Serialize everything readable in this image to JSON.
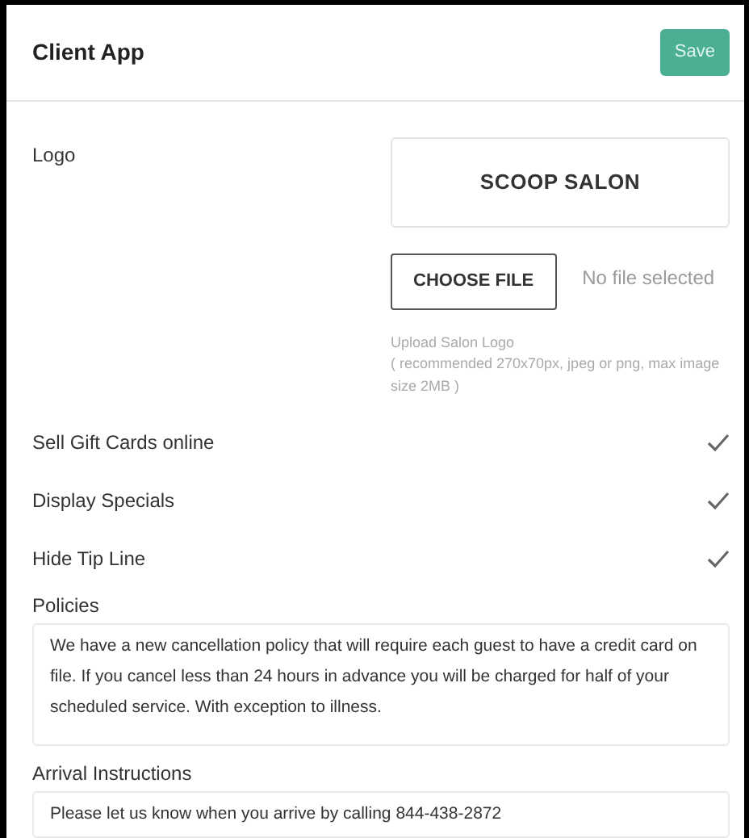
{
  "header": {
    "title": "Client App",
    "save_button": "Save"
  },
  "logo": {
    "label": "Logo",
    "image_text": "SCOOP SALON",
    "choose_button": "CHOOSE FILE",
    "file_status": "No file selected",
    "help_title": "Upload Salon Logo",
    "help_detail": "( recommended 270x70px, jpeg or png, max image size 2MB )"
  },
  "settings": [
    {
      "label": "Sell Gift Cards online",
      "checked": true
    },
    {
      "label": "Display Specials",
      "checked": true
    },
    {
      "label": "Hide Tip Line",
      "checked": true
    }
  ],
  "fields": [
    {
      "label": "Policies",
      "value": "We have a new cancellation policy that will require each guest to have a credit card on file. If you cancel less than 24 hours in advance you will be charged for half of your scheduled service. With exception to illness."
    },
    {
      "label": "Arrival Instructions",
      "value": "Please let us know when you arrive by calling  844-438-2872"
    }
  ]
}
